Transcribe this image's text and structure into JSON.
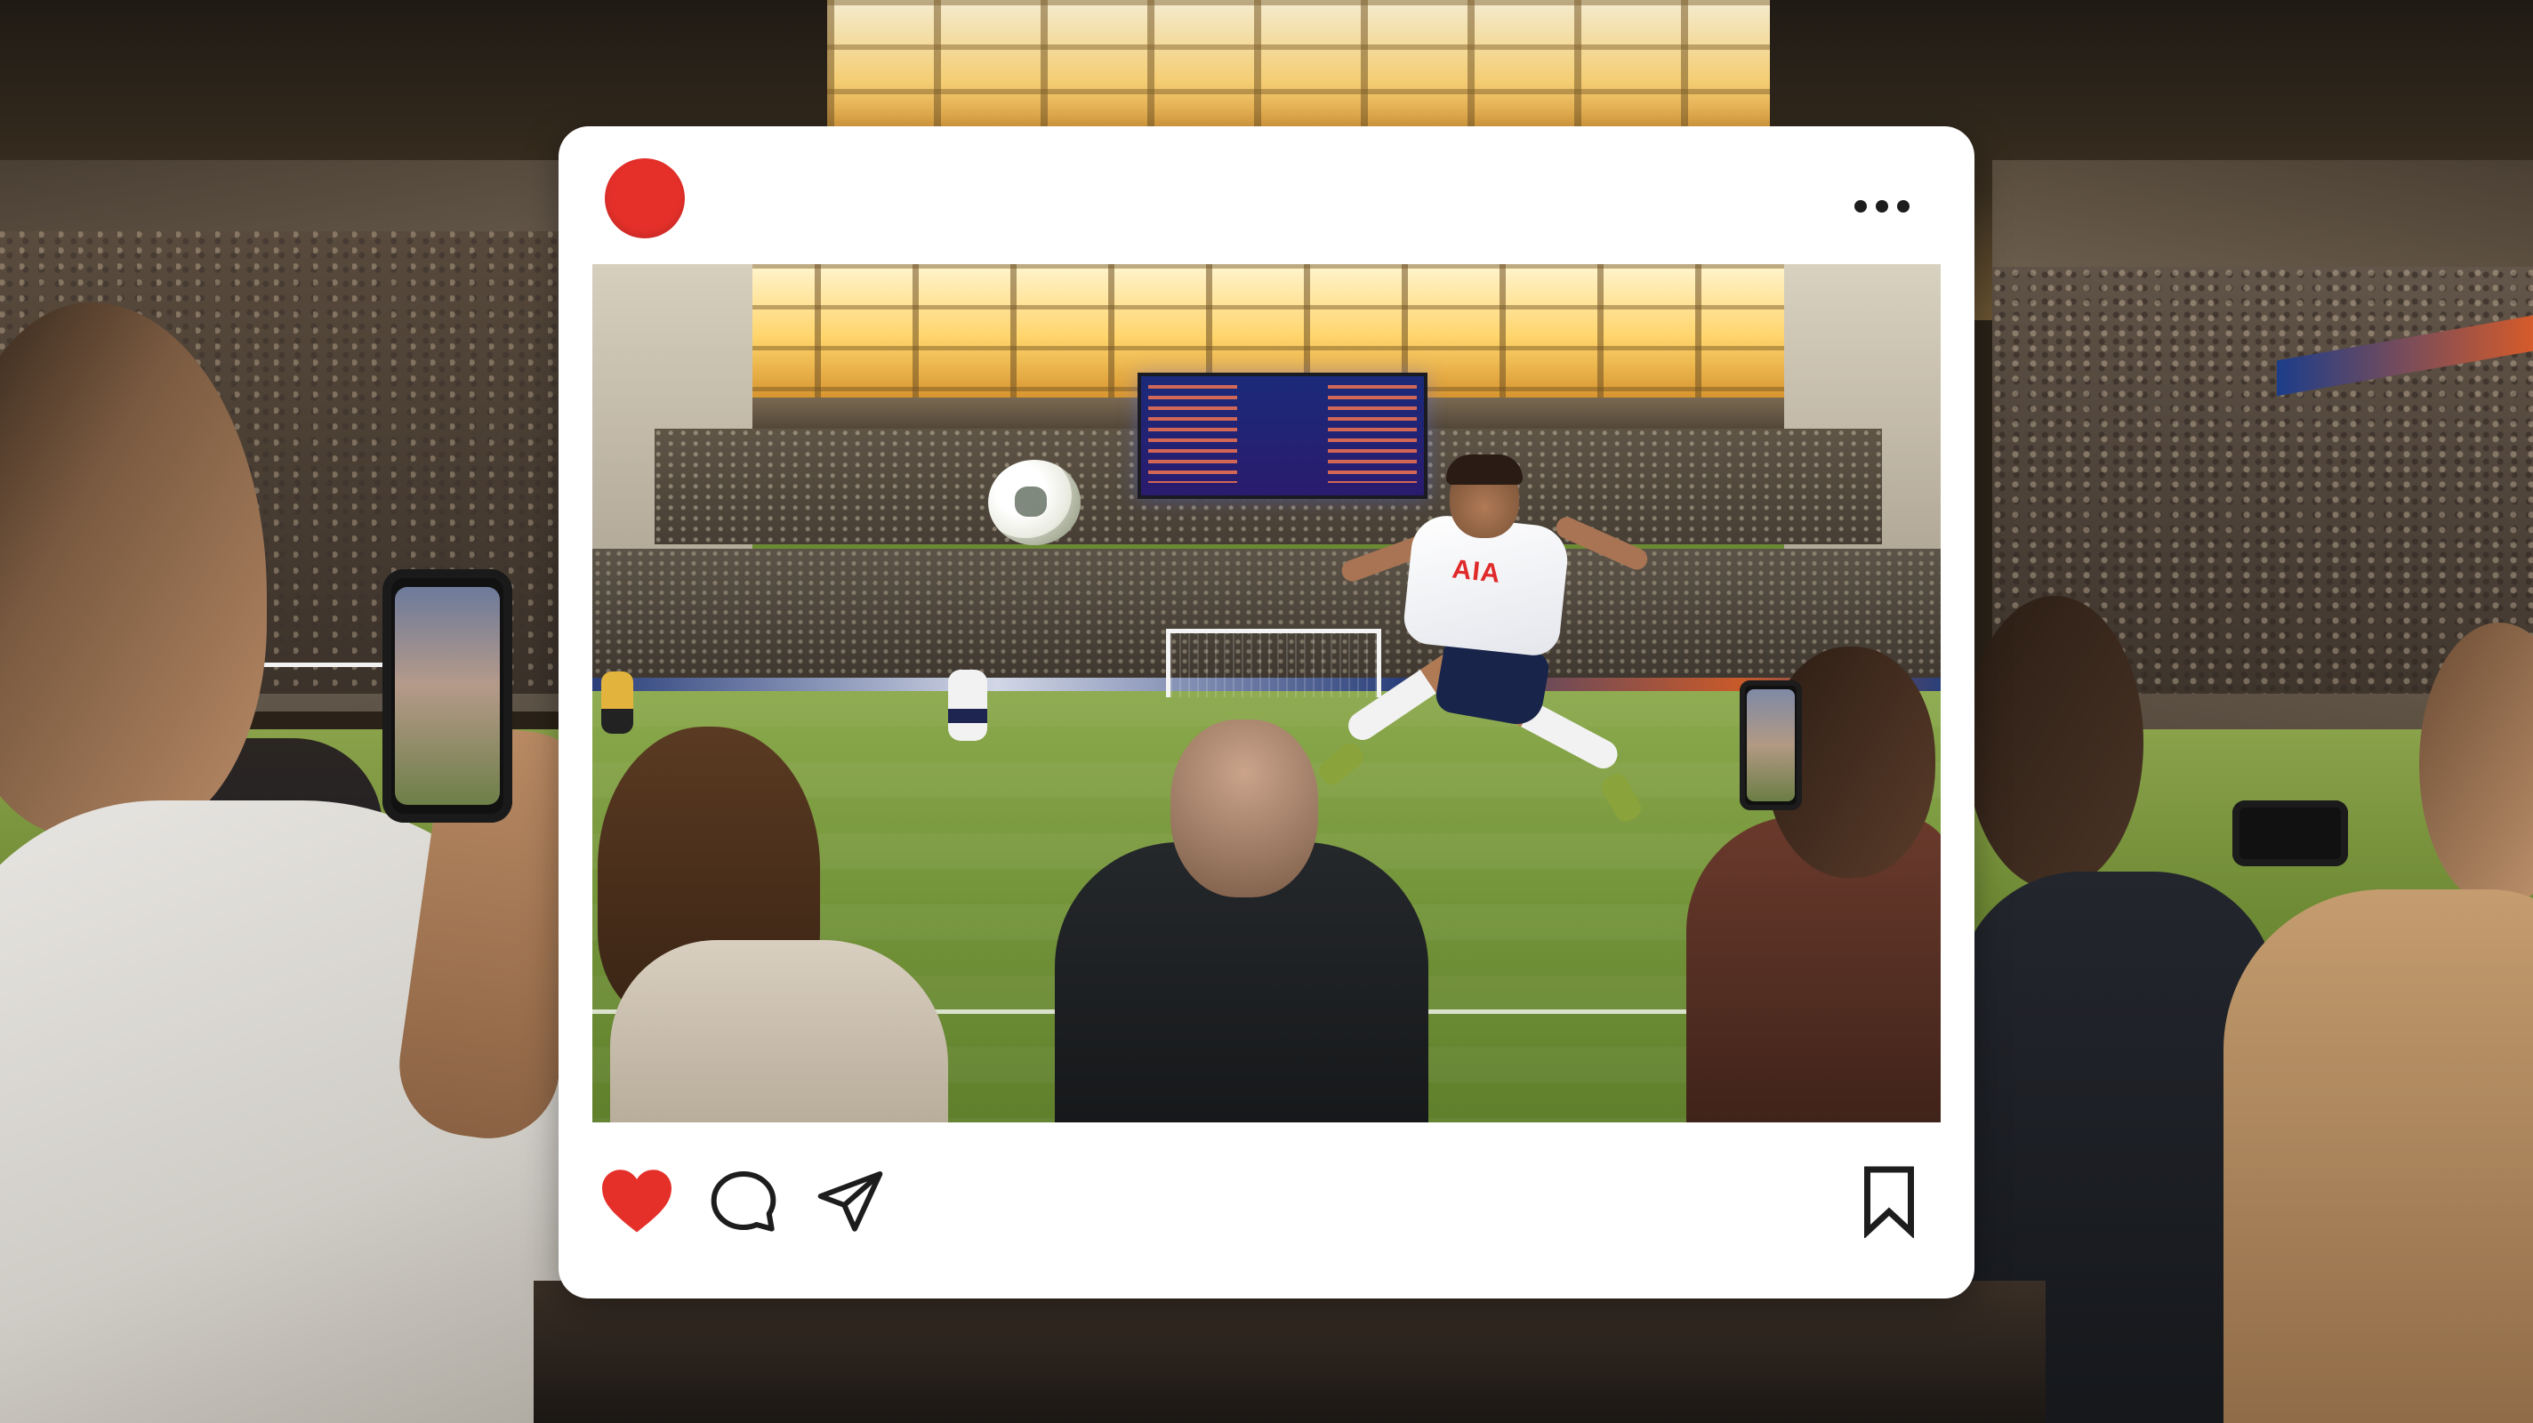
{
  "post": {
    "header": {
      "avatar": {
        "color": "#e5302a"
      },
      "more_icon": "more-horizontal-icon"
    },
    "media": {
      "jersey_sponsor": "AIA"
    },
    "actions": {
      "like_icon": "heart-filled-icon",
      "like_color": "#e5302a",
      "comment_icon": "comment-bubble-icon",
      "share_icon": "paper-plane-icon",
      "save_icon": "bookmark-outline-icon"
    }
  }
}
